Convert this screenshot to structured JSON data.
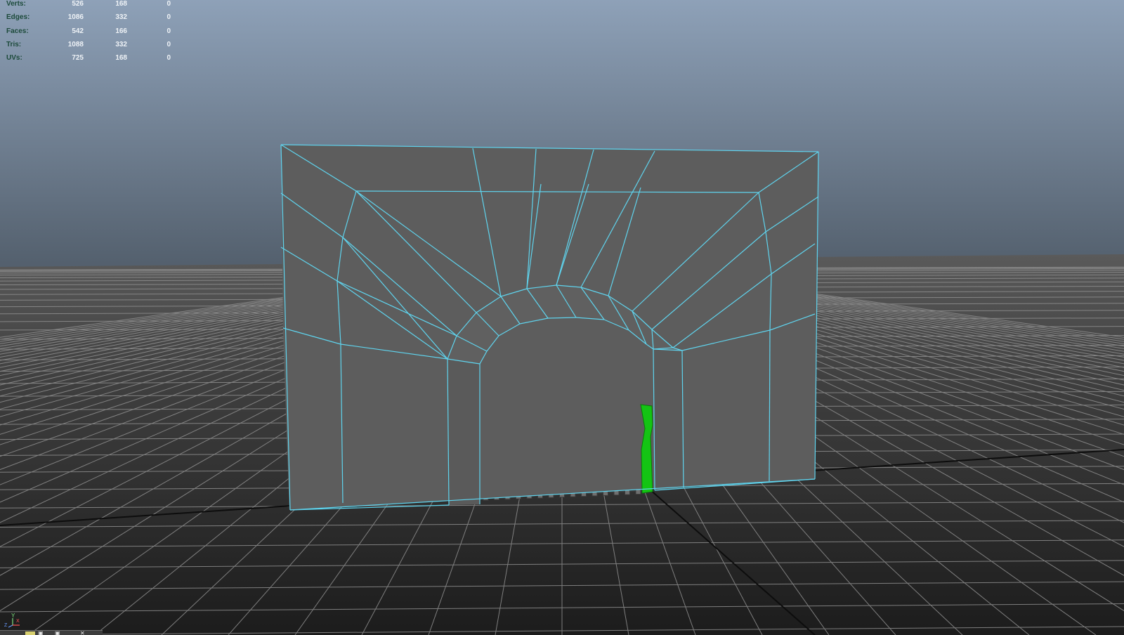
{
  "hud": {
    "rows": [
      {
        "label": "Verts:",
        "values": [
          "526",
          "168",
          "0"
        ]
      },
      {
        "label": "Edges:",
        "values": [
          "1086",
          "332",
          "0"
        ]
      },
      {
        "label": "Faces:",
        "values": [
          "542",
          "166",
          "0"
        ]
      },
      {
        "label": "Tris:",
        "values": [
          "1088",
          "332",
          "0"
        ]
      },
      {
        "label": "UVs:",
        "values": [
          "725",
          "168",
          "0"
        ]
      }
    ]
  },
  "axis_gizmo": {
    "y": "Y",
    "x": "X",
    "z": "Z"
  },
  "colors": {
    "sky_top": "#8ea1b8",
    "sky_bottom": "#4f5b68",
    "ground": "#2a2a2a",
    "grid_line": "#9a9a9a",
    "wall": "#5d5d5d",
    "wireframe": "#5fd4ee",
    "selection_green": "#14c414",
    "hud_label": "#1c4a3a"
  },
  "icons": {
    "toolbar": [
      "camera-icon",
      "layout-icon",
      "close-icon"
    ]
  }
}
